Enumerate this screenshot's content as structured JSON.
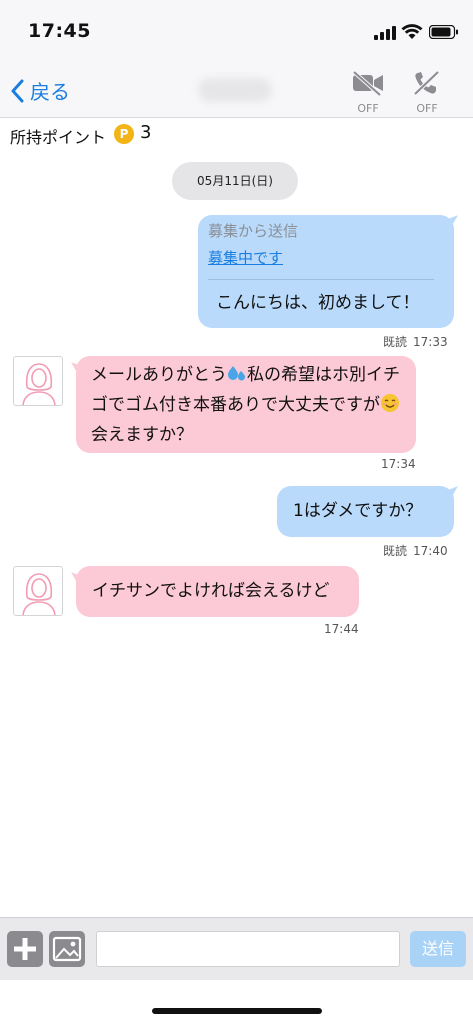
{
  "status_bar": {
    "time": "17:45"
  },
  "nav": {
    "back_label": "戻る",
    "video_status": "OFF",
    "call_status": "OFF"
  },
  "points": {
    "label": "所持ポイント",
    "coin_letter": "P",
    "value": "3"
  },
  "date_separator": "05月11日(日)",
  "messages": [
    {
      "direction": "out",
      "source": "募集から送信",
      "link": "募集中です",
      "text": "こんにちは、初めまして！",
      "read": "既読",
      "time": "17:33"
    },
    {
      "direction": "in",
      "text_part1": "メールありがとう",
      "text_part2": "私の希望はホ別イチゴでゴム付き本番ありで大丈夫ですが",
      "text_part3": "会えますか？",
      "time": "17:34"
    },
    {
      "direction": "out",
      "text": "1はダメですか？",
      "read": "既読",
      "time": "17:40"
    },
    {
      "direction": "in",
      "text": "イチサンでよければ会えるけど",
      "time": "17:44"
    }
  ],
  "composer": {
    "input_value": "",
    "send_label": "送信"
  },
  "colors": {
    "accent": "#1a7ee0",
    "outgoing_bubble": "#b9dafa",
    "incoming_bubble": "#fcc9d7",
    "coin": "#f3b416"
  }
}
